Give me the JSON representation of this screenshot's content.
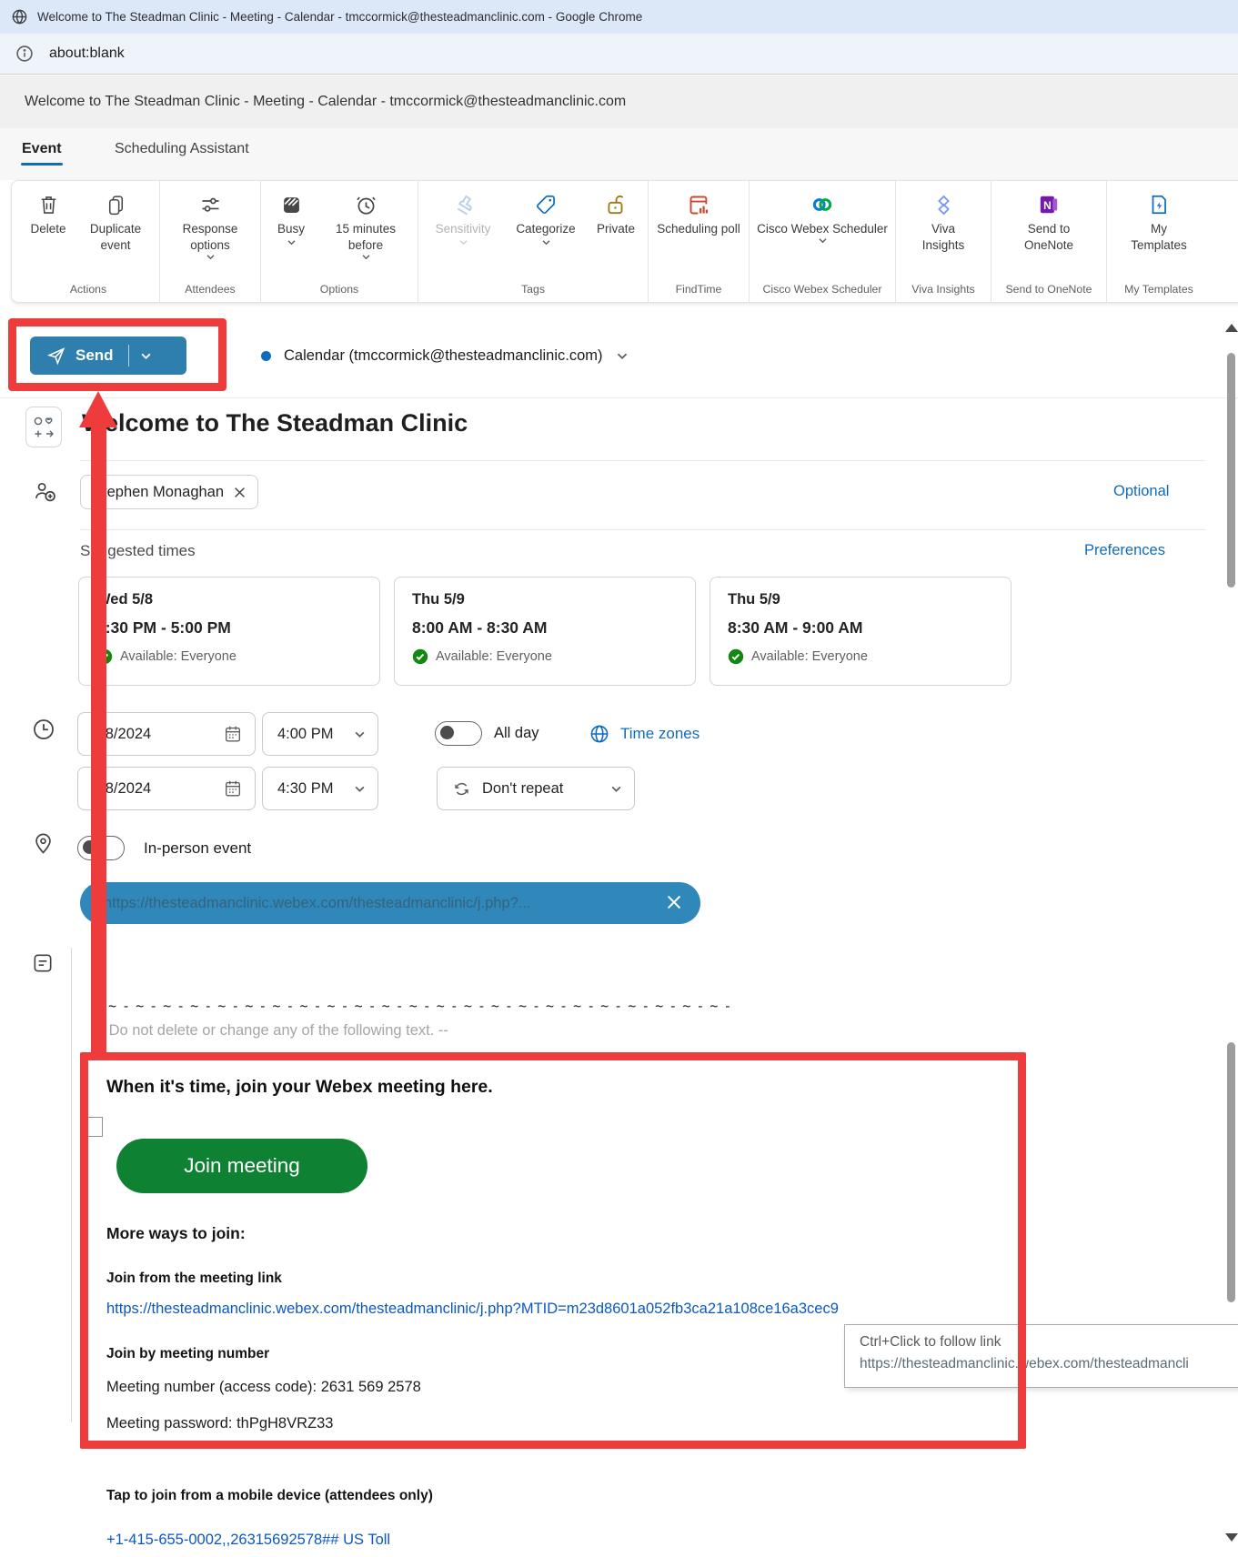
{
  "window": {
    "title": "Welcome to The Steadman Clinic - Meeting - Calendar - tmccormick@thesteadmanclinic.com - Google Chrome",
    "url": "about:blank",
    "page_header": "Welcome to The Steadman Clinic - Meeting - Calendar - tmccormick@thesteadmanclinic.com"
  },
  "tabs": [
    {
      "label": "Event",
      "active": true
    },
    {
      "label": "Scheduling Assistant",
      "active": false
    }
  ],
  "ribbon": {
    "groups": [
      {
        "label": "Actions",
        "buttons": [
          {
            "label": "Delete"
          },
          {
            "label": "Duplicate event"
          }
        ]
      },
      {
        "label": "Attendees",
        "buttons": [
          {
            "label": "Response options"
          }
        ]
      },
      {
        "label": "Options",
        "buttons": [
          {
            "label": "Busy"
          },
          {
            "label": "15 minutes before"
          }
        ]
      },
      {
        "label": "Tags",
        "buttons": [
          {
            "label": "Sensitivity"
          },
          {
            "label": "Categorize"
          },
          {
            "label": "Private"
          }
        ]
      },
      {
        "label": "FindTime",
        "buttons": [
          {
            "label": "Scheduling poll"
          }
        ]
      },
      {
        "label": "Cisco Webex Scheduler",
        "buttons": [
          {
            "label": "Cisco Webex Scheduler"
          }
        ]
      },
      {
        "label": "Viva Insights",
        "buttons": [
          {
            "label": "Viva Insights"
          }
        ]
      },
      {
        "label": "Send to OneNote",
        "buttons": [
          {
            "label": "Send to OneNote"
          }
        ]
      },
      {
        "label": "My Templates",
        "buttons": [
          {
            "label": "My Templates"
          }
        ]
      }
    ]
  },
  "send_area": {
    "send_label": "Send",
    "calendar_label": "Calendar (tmccormick@thesteadmanclinic.com)"
  },
  "form": {
    "title": "Welcome to The Steadman Clinic",
    "attendee": "Stephen Monaghan",
    "optional": "Optional",
    "suggested": {
      "label": "Suggested times",
      "preferences": "Preferences",
      "cards": [
        {
          "date": "Wed 5/8",
          "time": "4:30 PM - 5:00 PM",
          "availability": "Available: Everyone"
        },
        {
          "date": "Thu 5/9",
          "time": "8:00 AM - 8:30 AM",
          "availability": "Available: Everyone"
        },
        {
          "date": "Thu 5/9",
          "time": "8:30 AM - 9:00 AM",
          "availability": "Available: Everyone"
        }
      ]
    },
    "start_date": "5/8/2024",
    "start_time": "4:00 PM",
    "end_date": "5/8/2024",
    "end_time": "4:30 PM",
    "all_day_label": "All day",
    "time_zones_label": "Time zones",
    "repeat_label": "Don't repeat",
    "in_person_label": "In-person event",
    "location_pill": "https://thesteadmanclinic.webex.com/thesteadmanclinic/j.php?..."
  },
  "body_content": {
    "separator": "-~-~-~-~-~-~-~-~-~-~-~-~-~-~-~-~-~-~-~-~-~-~-~-",
    "notice": "-- Do not delete or change any of the following text. --",
    "webex": {
      "headline": "When it's time, join your Webex meeting here.",
      "join_button": "Join meeting",
      "more_ways": "More ways to join:",
      "link_heading": "Join from the meeting link",
      "link": "https://thesteadmanclinic.webex.com/thesteadmanclinic/j.php?MTID=m23d8601a052fb3ca21a108ce16a3cec9",
      "number_heading": "Join by meeting number",
      "number": "Meeting number (access code): 2631 569 2578",
      "password": "Meeting password: thPgH8VRZ33",
      "mobile_heading": "Tap to join from a mobile device (attendees only)",
      "mobile_number": "+1-415-655-0002,,26315692578## US Toll"
    }
  },
  "tooltip": {
    "line1": "Ctrl+Click to follow link",
    "line2": "https://thesteadmanclinic.webex.com/thesteadmancli"
  },
  "colors": {
    "accent_blue": "#0f6cbd",
    "send_button_blue": "#2e7fae",
    "location_pill_blue": "#3087ba",
    "join_green": "#0e8133",
    "link_blue": "#0a58c0",
    "annotation_red": "#ee3b3b"
  }
}
